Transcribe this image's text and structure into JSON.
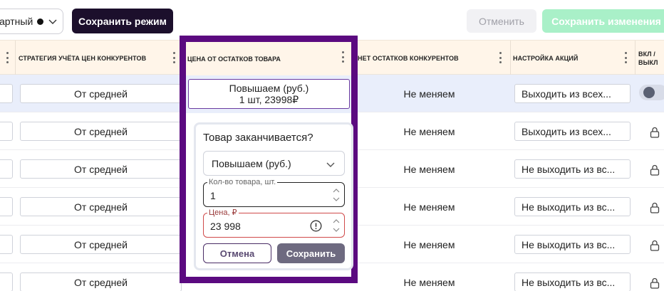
{
  "toolbar": {
    "mode_value": "артный",
    "save_mode_label": "Сохранить режим",
    "cancel_label": "Отменить",
    "save_changes_label": "Сохранить изменения"
  },
  "columns": [
    {
      "label": "СТРАТЕГИЯ УЧЁТА ЦЕН КОНКУРЕНТОВ"
    },
    {
      "label": "ЦЕНА ОТ ОСТАТКОВ ТОВАРА"
    },
    {
      "label": "НЕТ ОСТАТКОВ КОНКУРЕНТОВ"
    },
    {
      "label": "НАСТРОЙКА АКЦИЙ"
    },
    {
      "label": "ВКЛ / ВЫКЛ"
    }
  ],
  "rows": [
    {
      "strategy": "От средней",
      "no_stock": "Не меняем",
      "promo": "Выходить из всех..."
    },
    {
      "strategy": "От средней",
      "no_stock": "Не меняем",
      "promo": "Выходить из всех..."
    },
    {
      "strategy": "От средней",
      "no_stock": "Не меняем",
      "promo": "Не выходить из вс..."
    },
    {
      "strategy": "От средней",
      "no_stock": "Не меняем",
      "promo": "Не выходить из вс..."
    },
    {
      "strategy": "От средней",
      "no_stock": "Не меняем",
      "promo": "Не выходить из вс..."
    },
    {
      "strategy": "От средней",
      "no_stock": "Не меняем",
      "promo": "Не выходить из вс..."
    }
  ],
  "price_cell": {
    "line1": "Повышаем (руб.)",
    "line2": "1 шт, 23998₽"
  },
  "popover": {
    "title": "Товар заканчивается?",
    "select_value": "Повышаем (руб.)",
    "qty_label": "Кол-во товара, шт.",
    "qty_value": "1",
    "price_label": "Цена, ₽",
    "price_value": "23 998",
    "cancel_label": "Отмена",
    "save_label": "Сохранить"
  },
  "colors": {
    "highlight_frame": "#5b0a80",
    "primary_dark": "#1c0f2c",
    "save_disabled": "#a9f0c8",
    "header_bg": "#fff5e9",
    "selected_row": "#e9eefb",
    "error": "#d04a4a"
  },
  "icons": [
    "chevron-down-icon",
    "column-menu-icon",
    "lock-icon",
    "warning-icon",
    "spinner-arrows-icon"
  ]
}
